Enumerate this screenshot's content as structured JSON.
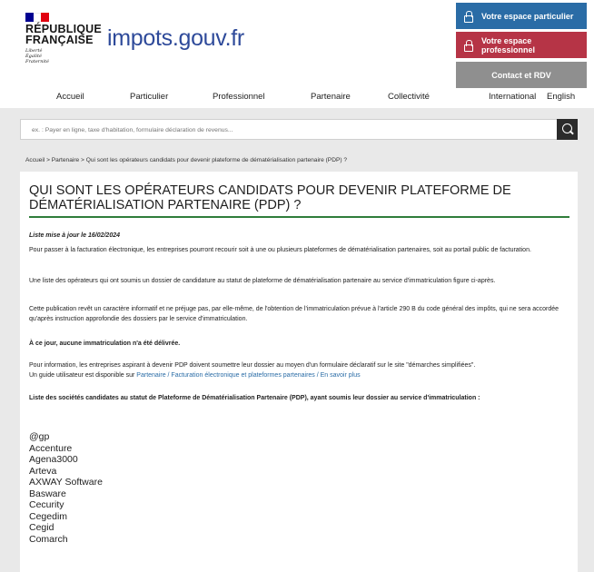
{
  "header": {
    "republic_line1": "RÉPUBLIQUE",
    "republic_line2": "FRANÇAISE",
    "motto": [
      "Liberté",
      "Égalité",
      "Fraternité"
    ],
    "site_name": "impots.gouv.fr",
    "buttons": {
      "particulier": "Votre espace particulier",
      "professionnel": "Votre espace professionnel",
      "contact": "Contact et RDV"
    },
    "flag_colors": [
      "#000091",
      "#ffffff",
      "#e1000f"
    ]
  },
  "nav": {
    "items": [
      "Accueil",
      "Particulier",
      "Professionnel",
      "Partenaire",
      "Collectivité",
      "International",
      "English"
    ]
  },
  "search": {
    "placeholder": "ex. : Payer en ligne, taxe d'habitation, formulaire déclaration de revenus..."
  },
  "breadcrumb": "Accueil > Partenaire > Qui sont les opérateurs candidats pour devenir plateforme de dématérialisation partenaire (PDP) ?",
  "main": {
    "title": "QUI SONT LES OPÉRATEURS CANDIDATS POUR DEVENIR PLATEFORME DE DÉMATÉRIALISATION PARTENAIRE (PDP) ?",
    "updated": "Liste mise à jour le 16/02/2024",
    "p1": "Pour passer à la facturation électronique, les entreprises pourront recourir soit à une ou plusieurs plateformes de dématérialisation partenaires, soit au portail public de facturation.",
    "p2": "Une liste des opérateurs qui ont soumis un dossier de candidature au statut de plateforme de dématérialisation partenaire au service d'immatriculation figure ci-après.",
    "p3": "Cette publication revêt un caractère informatif et ne préjuge pas, par elle-même, de l'obtention de l'immatriculation prévue à l'article 290 B du code général des impôts, qui ne sera accordée qu'après instruction approfondie des dossiers par le service d'immatriculation.",
    "p4": "À ce jour, aucune immatriculation n'a été délivrée.",
    "p5": "Pour information, les entreprises aspirant à devenir PDP doivent soumettre leur dossier au moyen d'un formulaire déclaratif sur le site \"démarches simplifiées\".",
    "p6_prefix": "Un guide utilisateur est disponible sur ",
    "p6_link": "Partenaire / Facturation électronique et plateformes partenaires / En savoir plus",
    "p7": "Liste des sociétés candidates au statut de Plateforme de Dématérialisation Partenaire (PDP), ayant soumis leur dossier au service d'immatriculation :",
    "companies": [
      "@gp",
      "Accenture",
      "Agena3000",
      "Arteva",
      "AXWAY Software",
      "Basware",
      "Cecurity",
      "Cegedim",
      "Cegid",
      "Comarch"
    ]
  }
}
